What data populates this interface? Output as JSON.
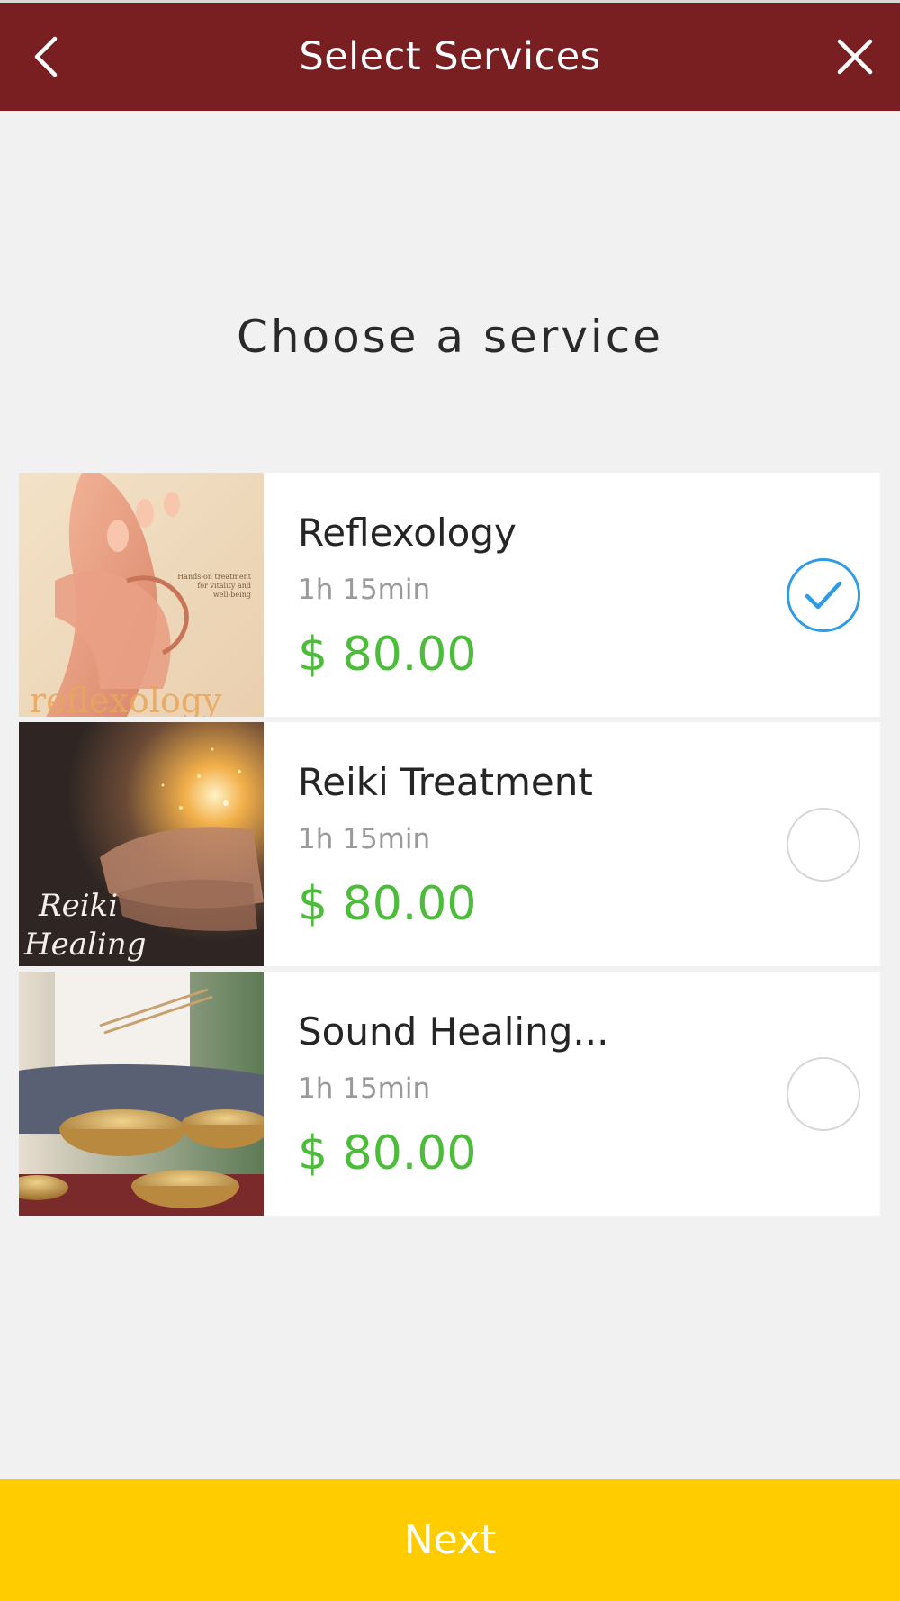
{
  "header": {
    "title": "Select Services",
    "back_icon": "chevron-left-icon",
    "close_icon": "close-icon",
    "background": "#7a1f21"
  },
  "main": {
    "heading": "Choose a service",
    "services": [
      {
        "name": "Reflexology",
        "duration": "1h 15min",
        "price": "$ 80.00",
        "selected": true,
        "image_text": "reflexology",
        "image_caption": "Hands-on treatment for vitality and well-being"
      },
      {
        "name": "Reiki Treatment",
        "duration": "1h 15min",
        "price": "$ 80.00",
        "selected": false,
        "image_text": "Reiki Healing"
      },
      {
        "name": "Sound Healing...",
        "duration": "1h 15min",
        "price": "$ 80.00",
        "selected": false
      }
    ]
  },
  "footer": {
    "next_label": "Next",
    "background": "#ffcc00"
  },
  "colors": {
    "price": "#4cbc3a",
    "check": "#2d9be6",
    "page_background": "#f1f1f1"
  }
}
